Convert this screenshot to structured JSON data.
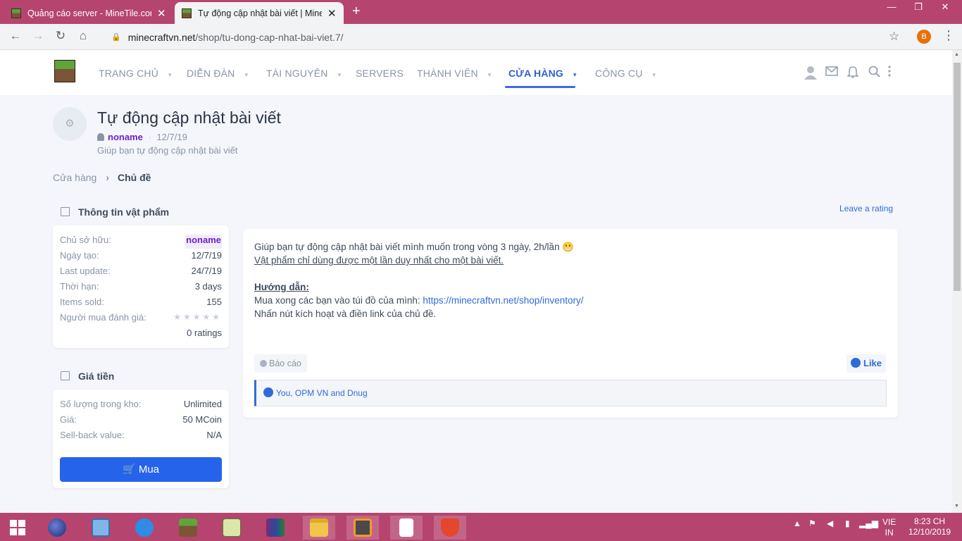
{
  "browser": {
    "tabs": [
      {
        "title": "Quảng cáo server - MineTile.com",
        "active": false
      },
      {
        "title": "Tự động cập nhật bài viết | Minec",
        "active": true
      }
    ],
    "url_host": "minecraftvn.net",
    "url_path": "/shop/tu-dong-cap-nhat-bai-viet.7/",
    "profile_initial": "B"
  },
  "nav": {
    "items": [
      {
        "label": "TRANG CHỦ",
        "caret": "▾"
      },
      {
        "label": "DIỄN ĐÀN",
        "caret": "▾"
      },
      {
        "label": "TÀI NGUYÊN",
        "caret": "▾"
      },
      {
        "label": "SERVERS",
        "caret": ""
      },
      {
        "label": "THÀNH VIÊN",
        "caret": "▾"
      },
      {
        "label": "CỬA HÀNG",
        "caret": "▾"
      },
      {
        "label": "CÔNG CỤ",
        "caret": "▾"
      }
    ],
    "active_index": 5
  },
  "page": {
    "title": "Tự động cập nhật bài viết",
    "author": "noname",
    "date": "12/7/19",
    "tagline": "Giúp bạn tự động cập nhật bài viết",
    "breadcrumb": [
      "Cửa hàng",
      "Chủ đề"
    ]
  },
  "item_info": {
    "heading": "Thông tin vật phẩm",
    "owner_label": "Chủ sở hữu:",
    "owner": "noname",
    "created_label": "Ngày tạo:",
    "created": "12/7/19",
    "updated_label": "Last update:",
    "updated": "24/7/19",
    "duration_label": "Thời hạn:",
    "duration": "3 days",
    "sold_label": "Items sold:",
    "sold": "155",
    "rating_label": "Người mua đánh giá:",
    "stars": "★★★★★",
    "rating_value": 0,
    "ratings_count": "0 ratings"
  },
  "price": {
    "heading": "Giá tiền",
    "stock_label": "Số lượng trong kho:",
    "stock": "Unlimited",
    "price_label": "Giá:",
    "price": "50 MCoin",
    "sellback_label": "Sell-back value:",
    "sellback": "N/A",
    "buy_label": "Mua"
  },
  "post": {
    "leave_rating": "Leave a rating",
    "line1": "Giúp bạn tự động cập nhật bài viết mình muốn trong vòng 3 ngày, 2h/lần",
    "line1_emoji": "😬",
    "line2": "Vật phẩm chỉ dùng được một lần duy nhất cho một bài viết.",
    "guide_title": "Hướng dẫn:",
    "guide1_text": "Mua xong các bạn vào túi đồ của mình: ",
    "guide1_link": "https://minecraftvn.net/shop/inventory/",
    "guide2": "Nhấn nút kích hoạt và điền link của chủ đề.",
    "report": "Báo cáo",
    "like": "Like",
    "likes_text": "You, OPM VN and Dnug"
  },
  "taskbar": {
    "lang_top": "VIE",
    "lang_bottom": "IN",
    "time": "8:23 CH",
    "date": "12/10/2019"
  },
  "colors": {
    "accent": "#2f6bd8",
    "buy": "#2563eb",
    "author": "#6b21c8",
    "chrome": "#b5456e"
  }
}
